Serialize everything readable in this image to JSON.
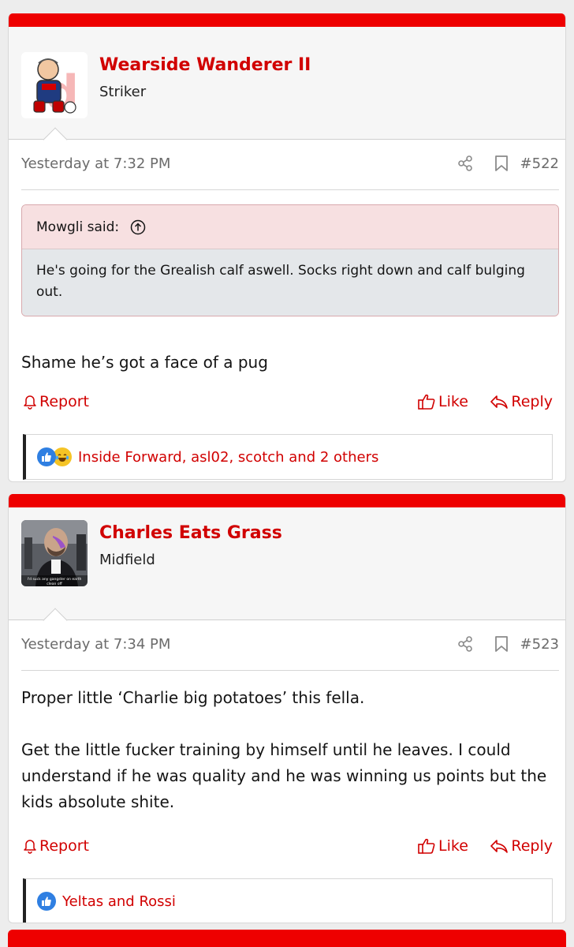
{
  "posts": [
    {
      "username": "Wearside Wanderer II",
      "user_title": "Striker",
      "date": "Yesterday at 7:32 PM",
      "post_number": "#522",
      "quote": {
        "author_label": "Mowgli said:",
        "text": "He's going for the Grealish calf aswell. Socks right down and calf bulging out."
      },
      "message": [
        "Shame he’s got a face of a pug"
      ],
      "actions": {
        "report": "Report",
        "like": "Like",
        "reply": "Reply"
      },
      "reactions": {
        "icons": [
          "like-icon",
          "laugh-icon"
        ],
        "text": "Inside Forward, asl02, scotch and 2 others"
      }
    },
    {
      "username": "Charles Eats Grass",
      "user_title": "Midfield",
      "avatar_caption": "I'd suck any gangster on earth clean off",
      "date": "Yesterday at 7:34 PM",
      "post_number": "#523",
      "message": [
        "Proper little ‘Charlie big potatoes’ this fella.",
        "Get the little fucker training by himself until he leaves. I could understand if he was quality and he was winning us points but the kids absolute shite."
      ],
      "actions": {
        "report": "Report",
        "like": "Like",
        "reply": "Reply"
      },
      "reactions": {
        "icons": [
          "like-icon"
        ],
        "text": "Yeltas and Rossi"
      }
    }
  ],
  "colors": {
    "accent": "#ee0000",
    "link": "#d10000",
    "quote_header_bg": "#f7e0e1",
    "quote_body_bg": "#e4e7ea"
  }
}
